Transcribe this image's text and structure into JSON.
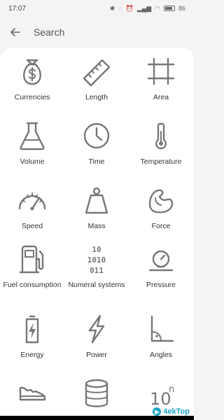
{
  "status_bar": {
    "time": "17:07",
    "battery": "86"
  },
  "search": {
    "label": "Search"
  },
  "categories": [
    {
      "label": "Currencies",
      "icon": "money-bag-icon"
    },
    {
      "label": "Length",
      "icon": "ruler-icon"
    },
    {
      "label": "Area",
      "icon": "area-grid-icon"
    },
    {
      "label": "Volume",
      "icon": "flask-icon"
    },
    {
      "label": "Time",
      "icon": "clock-icon"
    },
    {
      "label": "Temperature",
      "icon": "thermometer-icon"
    },
    {
      "label": "Speed",
      "icon": "speedometer-icon"
    },
    {
      "label": "Mass",
      "icon": "weight-icon"
    },
    {
      "label": "Force",
      "icon": "flexed-arm-icon"
    },
    {
      "label": "Fuel consumption",
      "icon": "fuel-pump-icon"
    },
    {
      "label": "Numeral systems",
      "icon": "binary-digits-icon"
    },
    {
      "label": "Pressure",
      "icon": "pressure-gauge-icon"
    },
    {
      "label": "Energy",
      "icon": "battery-icon"
    },
    {
      "label": "Power",
      "icon": "lightning-icon"
    },
    {
      "label": "Angles",
      "icon": "angle-icon"
    },
    {
      "label": "",
      "icon": "shoe-icon"
    },
    {
      "label": "",
      "icon": "database-icon"
    },
    {
      "label": "",
      "icon": "power-ten-icon"
    }
  ],
  "icon_text": {
    "binary_row_1": "10",
    "binary_row_2": "1010",
    "binary_row_3": "011",
    "power_base": "10",
    "power_exp": "n"
  },
  "watermark": {
    "text": "4ekTop"
  },
  "colors": {
    "icon": "#777777",
    "background": "#f4f4f4",
    "panel": "#ffffff"
  }
}
